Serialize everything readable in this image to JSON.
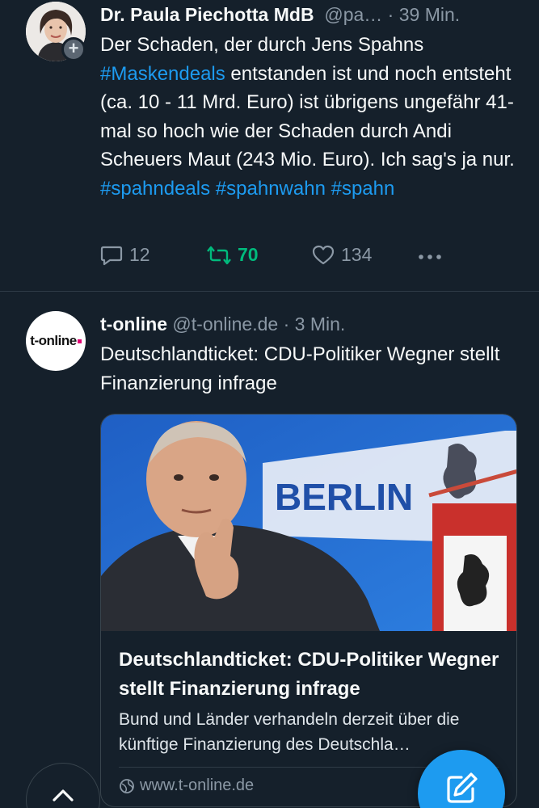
{
  "colors": {
    "background": "#15202b",
    "accent": "#1d9bf0",
    "retweet_active": "#00ba7c",
    "secondary_text": "#8b98a5"
  },
  "tweets": [
    {
      "author_name": "Dr. Paula Piechotta MdB",
      "handle": "@pa…",
      "time": " · 39 Min.",
      "avatar_icon": "profile-photo",
      "badge_icon": "plus-icon",
      "text_segments": [
        {
          "text": "Der Schaden, der durch Jens Spahns ",
          "hashtag": false
        },
        {
          "text": "#Maskendeals",
          "hashtag": true
        },
        {
          "text": " entstanden ist und noch entsteht (ca. 10 - 11 Mrd. Euro) ist übrigens ungefähr 41-mal so hoch wie der Schaden durch Andi Scheuers Maut (243 Mio. Euro). Ich sag's ja nur. ",
          "hashtag": false
        },
        {
          "text": "#spahndeals",
          "hashtag": true
        },
        {
          "text": " ",
          "hashtag": false
        },
        {
          "text": "#spahnwahn",
          "hashtag": true
        },
        {
          "text": " ",
          "hashtag": false
        },
        {
          "text": "#spahn",
          "hashtag": true
        }
      ],
      "actions": {
        "replies": "12",
        "retweets": "70",
        "likes": "134"
      }
    },
    {
      "author_name": "t-online",
      "handle": " @t-online.de",
      "time": " · 3 Min.",
      "avatar_logo_text": "t-online",
      "text": "Deutschlandticket: CDU-Politiker Wegner stellt Finanzierung infrage",
      "card": {
        "image_sign_text": "BERLIN",
        "title": "Deutschlandticket: CDU-Politiker Wegner stellt Finanzierung infrage",
        "description": "Bund und Länder verhandeln derzeit über die künftige Finanzierung des Deutschla…",
        "domain": "www.t-online.de",
        "domain_icon": "link-globe-icon"
      }
    }
  ],
  "floating": {
    "scroll_top_icon": "chevron-up-icon",
    "compose_icon": "compose-icon"
  }
}
